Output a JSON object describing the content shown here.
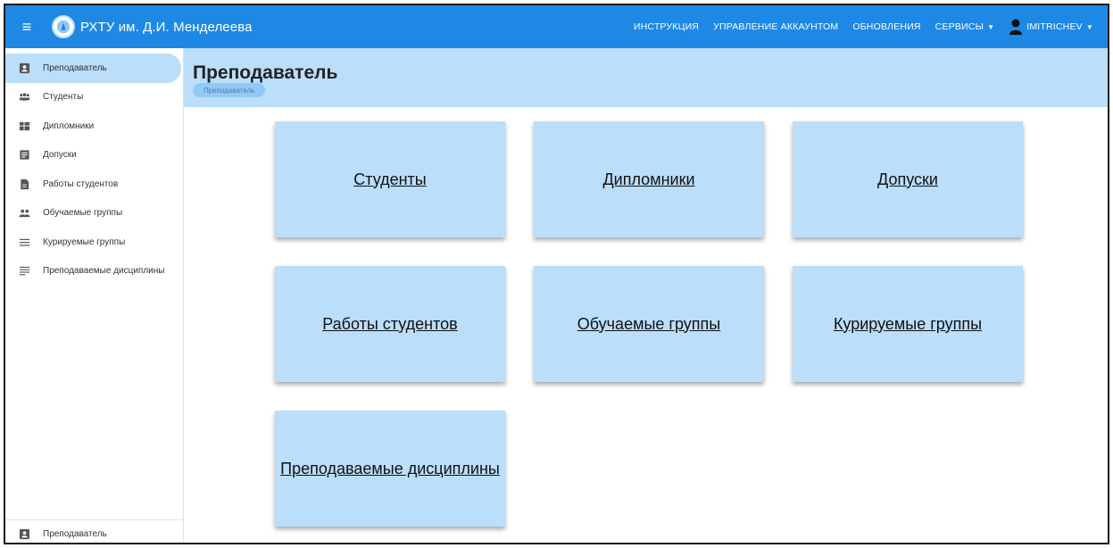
{
  "header": {
    "brand": "РХТУ им. Д.И. Менделеева",
    "nav": {
      "instruction": "ИНСТРУКЦИЯ",
      "account": "УПРАВЛЕНИЕ АККАУНТОМ",
      "updates": "ОБНОВЛЕНИЯ",
      "services": "СЕРВИСЫ",
      "user": "IMITRICHEV"
    }
  },
  "sidebar": {
    "items": [
      {
        "label": "Преподаватель",
        "icon": "account-box-icon"
      },
      {
        "label": "Студенты",
        "icon": "people-icon"
      },
      {
        "label": "Дипломники",
        "icon": "grid-icon"
      },
      {
        "label": "Допуски",
        "icon": "document-icon"
      },
      {
        "label": "Работы студентов",
        "icon": "file-icon"
      },
      {
        "label": "Обучаемые группы",
        "icon": "group-icon"
      },
      {
        "label": "Курируемые группы",
        "icon": "menu-icon"
      },
      {
        "label": "Преподаваемые дисциплины",
        "icon": "subject-icon"
      }
    ],
    "footer_label": "Преподаватель"
  },
  "page": {
    "title": "Преподаватель",
    "breadcrumb": "Преподаватель"
  },
  "cards": [
    "Студенты",
    "Дипломники",
    "Допуски",
    "Работы студентов",
    "Обучаемые группы",
    "Курируемые группы",
    "Преподаваемые дисциплины"
  ],
  "colors": {
    "primary": "#1e88e5",
    "light": "#bbdefb"
  }
}
